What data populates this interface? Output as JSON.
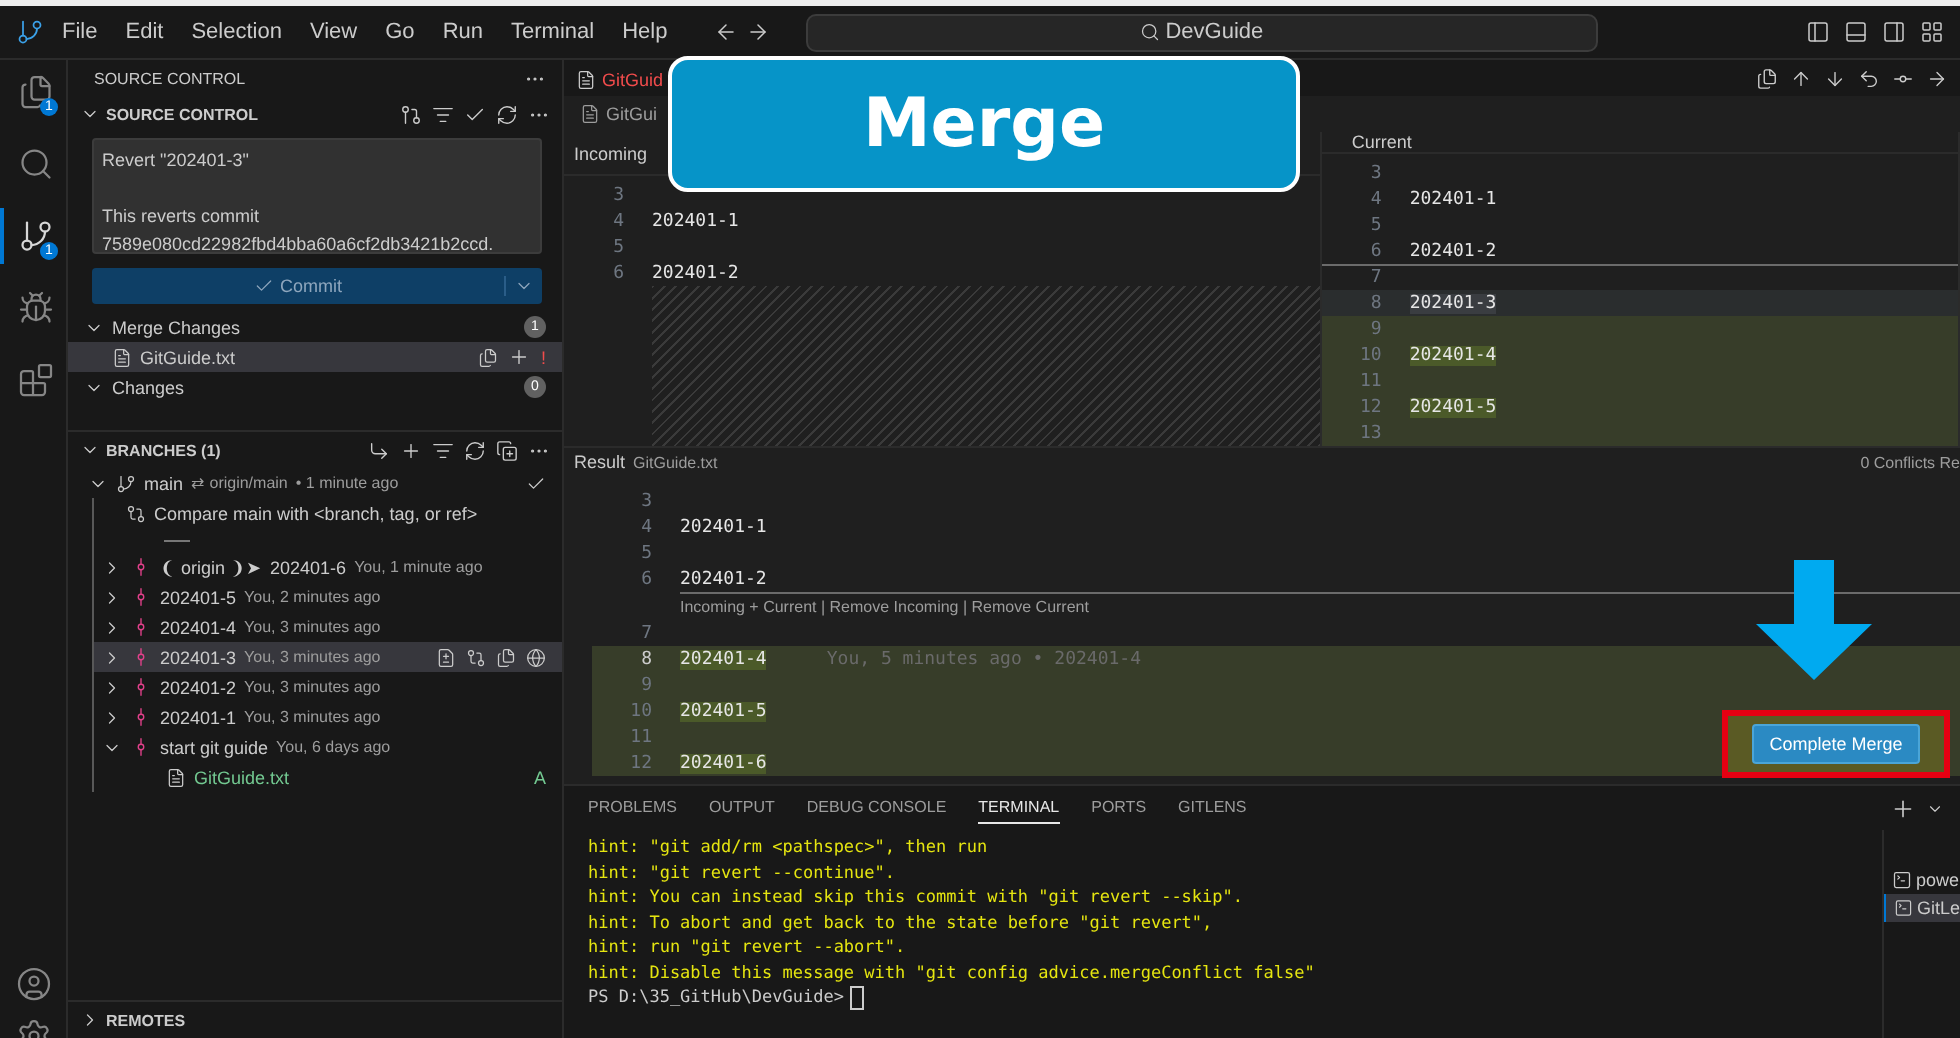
{
  "title_bar": {
    "menu": [
      "File",
      "Edit",
      "Selection",
      "View",
      "Go",
      "Run",
      "Terminal",
      "Help"
    ],
    "search": "DevGuide"
  },
  "activity_bar": {
    "items": [
      {
        "kind": "explorer",
        "badge": "1",
        "selected": false
      },
      {
        "kind": "search",
        "selected": false
      },
      {
        "kind": "scm",
        "badge": "1",
        "selected": true
      },
      {
        "kind": "debug",
        "selected": false
      },
      {
        "kind": "extensions",
        "selected": false
      }
    ]
  },
  "sidebar": {
    "header": "SOURCE CONTROL",
    "section_title": "SOURCE CONTROL",
    "commit_message": "Revert \"202401-3\"\n\nThis reverts commit 7589e080cd22982fbd4bba60a6cf2db3421b2ccd.",
    "commit_button": "Commit",
    "groups": [
      {
        "label": "Merge Changes",
        "count": "1",
        "files": [
          {
            "name": "GitGuide.txt",
            "status": "!"
          }
        ]
      },
      {
        "label": "Changes",
        "count": "0"
      }
    ],
    "branches": {
      "title": "BRANCHES (1)",
      "branch": "main",
      "upstream": "⇄ origin/main",
      "time": "• 1 minute ago",
      "compare": "Compare main with <branch, tag, or ref>",
      "commits": [
        {
          "ref": "❨ origin ❩➤",
          "message": "202401-6",
          "info": "You, 1 minute ago",
          "selected": false,
          "expanded": false
        },
        {
          "message": "202401-5",
          "info": "You, 2 minutes ago",
          "selected": false,
          "expanded": false
        },
        {
          "message": "202401-4",
          "info": "You, 3 minutes ago",
          "selected": false,
          "expanded": false
        },
        {
          "message": "202401-3",
          "info": "You, 3 minutes ago",
          "selected": true,
          "expanded": false
        },
        {
          "message": "202401-2",
          "info": "You, 3 minutes ago",
          "selected": false,
          "expanded": false
        },
        {
          "message": "202401-1",
          "info": "You, 3 minutes ago",
          "selected": false,
          "expanded": false
        },
        {
          "message": "start git guide",
          "info": "You, 6 days ago",
          "selected": false,
          "expanded": true,
          "files": [
            {
              "name": "GitGuide.txt",
              "status": "A"
            }
          ]
        }
      ]
    },
    "remotes": "REMOTES"
  },
  "editor": {
    "tabs": [
      {
        "label": "GitGuid",
        "selected": false,
        "conflict": true
      }
    ],
    "breadcrumb": "GitGui",
    "incoming": {
      "title": "Incoming",
      "lines": [
        {
          "n": "3"
        },
        {
          "n": "4",
          "text": "202401-1"
        },
        {
          "n": "5"
        },
        {
          "n": "6",
          "text": "202401-2"
        }
      ]
    },
    "current": {
      "title": "Current",
      "lines": [
        {
          "n": "3"
        },
        {
          "n": "4",
          "text": "202401-1"
        },
        {
          "n": "5"
        },
        {
          "n": "6",
          "text": "202401-2"
        },
        {
          "n": "7",
          "conflict_start": true
        },
        {
          "n": "8",
          "text": "202401-3",
          "removed": true
        },
        {
          "n": "9",
          "added": true
        },
        {
          "n": "10",
          "text": "202401-4",
          "added": true
        },
        {
          "n": "11",
          "added": true
        },
        {
          "n": "12",
          "text": "202401-5",
          "added": true
        },
        {
          "n": "13",
          "added": true
        }
      ]
    },
    "result": {
      "title": "Result",
      "file": "GitGuide.txt",
      "conflicts": "0 Conflicts Re",
      "codelens": "Incoming + Current | Remove Incoming | Remove Current",
      "lines": [
        {
          "n": "3"
        },
        {
          "n": "4",
          "text": "202401-1"
        },
        {
          "n": "5"
        },
        {
          "n": "6",
          "text": "202401-2"
        },
        {
          "n": "7"
        },
        {
          "n": "8",
          "text": "202401-4",
          "added": true,
          "current": true,
          "blame": "You, 5 minutes ago • 202401-4"
        },
        {
          "n": "9",
          "added": true
        },
        {
          "n": "10",
          "text": "202401-5",
          "added": true
        },
        {
          "n": "11",
          "added": true
        },
        {
          "n": "12",
          "text": "202401-6",
          "added": true
        }
      ]
    },
    "complete_button": "Complete Merge"
  },
  "overlay_label": "Merge",
  "panel": {
    "tabs": [
      {
        "label": "PROBLEMS",
        "selected": false
      },
      {
        "label": "OUTPUT",
        "selected": false
      },
      {
        "label": "DEBUG CONSOLE",
        "selected": false
      },
      {
        "label": "TERMINAL",
        "selected": true
      },
      {
        "label": "PORTS",
        "selected": false
      },
      {
        "label": "GITLENS",
        "selected": false
      }
    ],
    "terminal_lines": [
      {
        "kind": "hint",
        "text": "hint: \"git add/rm <pathspec>\", then run"
      },
      {
        "kind": "hint",
        "text": "hint: \"git revert --continue\"."
      },
      {
        "kind": "hint",
        "text": "hint: You can instead skip this commit with \"git revert --skip\"."
      },
      {
        "kind": "hint",
        "text": "hint: To abort and get back to the state before \"git revert\","
      },
      {
        "kind": "hint",
        "text": "hint: run \"git revert --abort\"."
      },
      {
        "kind": "hint",
        "text": "hint: Disable this message with \"git config advice.mergeConflict false\""
      },
      {
        "kind": "prompt",
        "text": "PS D:\\35_GitHub\\DevGuide>"
      }
    ],
    "terminals": [
      {
        "label": "powe",
        "selected": false
      },
      {
        "label": "GitLe",
        "selected": true
      }
    ]
  }
}
